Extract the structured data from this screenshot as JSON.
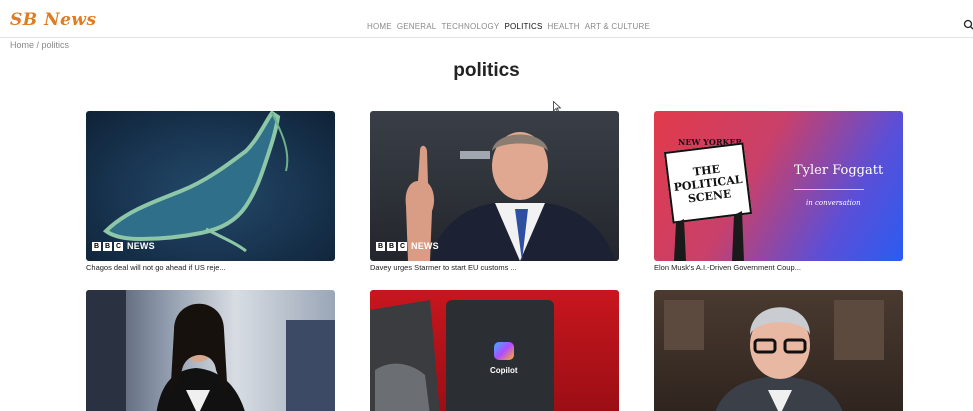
{
  "brand": {
    "logo": "SB News"
  },
  "nav": {
    "items": [
      {
        "label": "HOME",
        "active": false
      },
      {
        "label": "GENERAL",
        "active": false
      },
      {
        "label": "TECHNOLOGY",
        "active": false
      },
      {
        "label": "POLITICS",
        "active": true
      },
      {
        "label": "HEALTH",
        "active": false
      },
      {
        "label": "ART & CULTURE",
        "active": false
      }
    ]
  },
  "breadcrumb": {
    "home": "Home",
    "separator": " / ",
    "current": "politics"
  },
  "page": {
    "title": "politics"
  },
  "cards": [
    {
      "caption": "Chagos deal will not go ahead if US reje...",
      "badge": "NEWS"
    },
    {
      "caption": "Davey urges Starmer to start EU customs ...",
      "badge": "NEWS"
    },
    {
      "caption": "Elon Musk's A.I.-Driven Government Coup..."
    },
    {
      "caption": ""
    },
    {
      "caption": ""
    },
    {
      "caption": ""
    }
  ],
  "newyorker": {
    "masthead": "NEW YORKER",
    "sign_lines": [
      "THE",
      "POLITICAL",
      "SCENE"
    ],
    "name": "Tyler Foggatt",
    "subtitle": "in conversation"
  },
  "copilot": {
    "title": "Copilot"
  },
  "colors": {
    "brand": "#e07b1f",
    "nav_inactive": "#8a8a8a",
    "nav_active": "#111111",
    "newyorker_gradient": [
      "#e23a4a",
      "#2a5cf0"
    ]
  }
}
